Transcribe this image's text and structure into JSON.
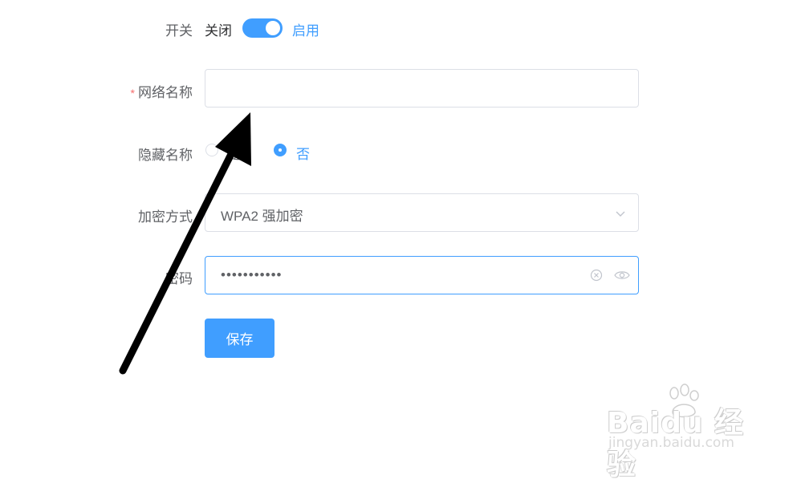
{
  "form": {
    "switch_label": "开关",
    "switch_off_text": "关闭",
    "switch_on_text": "启用",
    "switch_state": "on",
    "required_mark": "*",
    "ssid_label": "网络名称",
    "ssid_value": "",
    "hide_label": "隐藏名称",
    "hide_options": [
      {
        "label": "是",
        "checked": false
      },
      {
        "label": "否",
        "checked": true
      }
    ],
    "encryption_label": "加密方式",
    "encryption_value": "WPA2 强加密",
    "password_label": "密码",
    "password_value": "•••••••••••",
    "save_label": "保存"
  },
  "watermark": {
    "logo_text": "Baidu 经验",
    "url": "jingyan.baidu.com"
  },
  "colors": {
    "primary": "#409eff",
    "required": "#f56c6c",
    "annotation_arrow": "#000000"
  },
  "icons": [
    "chevron-down-icon",
    "clear-circle-icon",
    "eye-icon",
    "paw-icon"
  ]
}
